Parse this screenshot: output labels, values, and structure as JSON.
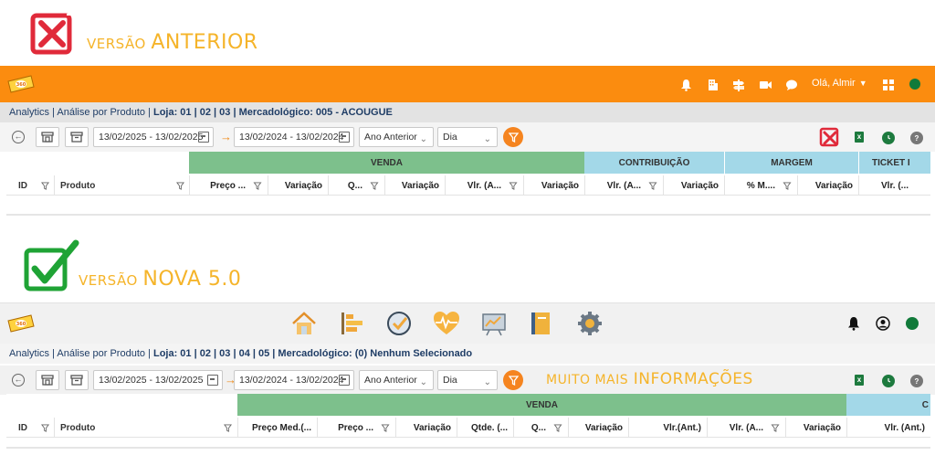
{
  "old": {
    "badge": {
      "prefix": "VERSÃO",
      "word": "ANTERIOR"
    },
    "topbar": {
      "greeting": "Olá, Almir"
    },
    "breadcrumb": {
      "text1": "Analytics | Análise por Produto | ",
      "loja": "Loja: 01 | 02 | 03 | Mercadológico: 005 - ACOUGUE"
    },
    "filters": {
      "date1": "13/02/2025 - 13/02/2025",
      "date2": "13/02/2024 - 13/02/2024",
      "compare": "Ano Anterior",
      "period": "Dia"
    },
    "table": {
      "id": "ID",
      "produto": "Produto",
      "groups": {
        "venda": "VENDA",
        "contribuicao": "CONTRIBUIÇÃO",
        "margem": "MARGEM",
        "ticket": "TICKET I"
      },
      "columns": [
        "Preço ...",
        "Variação",
        "Q...",
        "Variação",
        "Vlr. (A...",
        "Variação",
        "Vlr. (A...",
        "Variação",
        "% M....",
        "Variação",
        "Vlr. (..."
      ]
    }
  },
  "new": {
    "badge": {
      "prefix": "VERSÃO",
      "word": "NOVA 5.0"
    },
    "breadcrumb": {
      "text1": "Analytics | Análise por Produto | ",
      "loja": "Loja: 01 | 02 | 03 | 04 | 05 | Mercadológico: (0) Nenhum Selecionado"
    },
    "filters": {
      "date1": "13/02/2025 - 13/02/2025",
      "date2": "13/02/2024 - 13/02/2024",
      "compare": "Ano Anterior",
      "period": "Dia",
      "promo_prefix": "MUITO MAIS",
      "promo_word": "INFORMAÇÕES"
    },
    "table": {
      "id": "ID",
      "produto": "Produto",
      "groups": {
        "venda": "VENDA",
        "next": "C"
      },
      "columns": [
        "Preço Med.(...",
        "Preço ...",
        "Variação",
        "Qtde. (...",
        "Q...",
        "Variação",
        "Vlr.(Ant.)",
        "Vlr. (A...",
        "Variação",
        "Vlr. (Ant.)"
      ]
    }
  },
  "colors": {
    "orange": "#fb8c0f",
    "venda": "#7dc08c",
    "contrib": "#a3d8e8",
    "badge": "#f5b42a"
  }
}
